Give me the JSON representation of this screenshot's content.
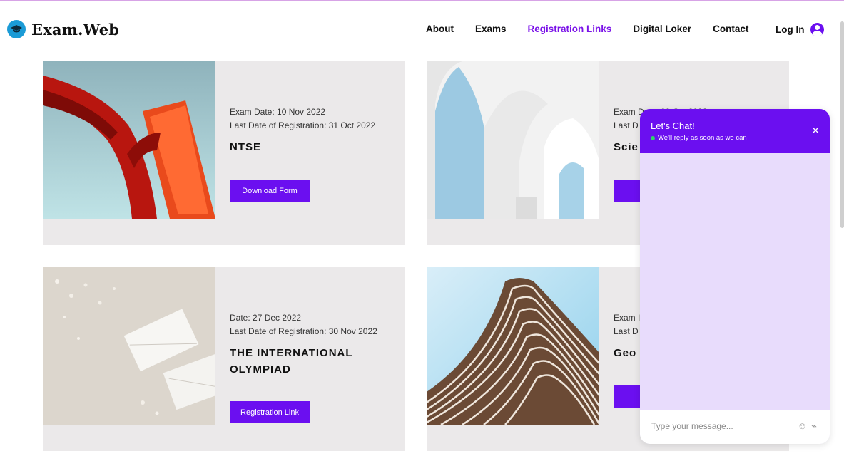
{
  "header": {
    "brand": "Exam.Web",
    "nav": [
      "About",
      "Exams",
      "Registration Links",
      "Digital Loker",
      "Contact"
    ],
    "active_nav": "Registration Links",
    "login": "Log In"
  },
  "cards": [
    {
      "line1": "Exam Date: 10 Nov  2022",
      "line2": "Last Date of Registration: 31 Oct 2022",
      "title": "NTSE",
      "button": "Download Form"
    },
    {
      "line1": "Exam Date: 09 Oct 2022",
      "line2": "Last D",
      "title": "Scie",
      "button": "Dow"
    },
    {
      "line1": "Date: 27 Dec 2022",
      "line2": "Last Date of Registration: 30 Nov 2022",
      "title": "THE INTERNATIONAL OLYMPIAD",
      "button": "Registration Link"
    },
    {
      "line1": "Exam I",
      "line2": "Last D",
      "title": "Geo",
      "button": "Regi"
    }
  ],
  "chat": {
    "title": "Let's Chat!",
    "subtitle": "We'll reply as soon as we can",
    "close_icon": "close-icon",
    "placeholder": "Type your message...",
    "emoji_icon": "smiley-icon",
    "attach_icon": "paperclip-icon"
  },
  "colors": {
    "accent": "#6b0ff0",
    "card_bg": "#ebe9ea",
    "chat_body": "#e8dcfc"
  }
}
